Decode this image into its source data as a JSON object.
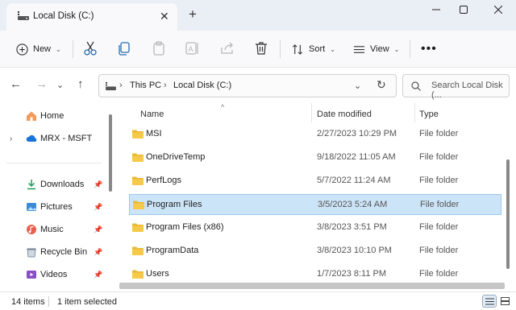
{
  "window": {
    "tab_title": "Local Disk (C:)"
  },
  "toolbar": {
    "new_label": "New",
    "sort_label": "Sort",
    "view_label": "View"
  },
  "address": {
    "crumbs": [
      "This PC",
      "Local Disk (C:)"
    ]
  },
  "search": {
    "placeholder": "Search Local Disk (..."
  },
  "sidebar": {
    "items": [
      {
        "label": "Home",
        "icon": "home-icon"
      },
      {
        "label": "MRX - MSFT",
        "icon": "cloud-icon"
      },
      {
        "label": "Downloads",
        "icon": "download-icon"
      },
      {
        "label": "Pictures",
        "icon": "pictures-icon"
      },
      {
        "label": "Music",
        "icon": "music-icon"
      },
      {
        "label": "Recycle Bin",
        "icon": "recycle-bin-icon"
      },
      {
        "label": "Videos",
        "icon": "videos-icon"
      }
    ]
  },
  "columns": {
    "name": "Name",
    "date": "Date modified",
    "type": "Type"
  },
  "files": [
    {
      "name": "MSI",
      "date": "2/27/2023 10:29 PM",
      "type": "File folder"
    },
    {
      "name": "OneDriveTemp",
      "date": "9/18/2022 11:05 AM",
      "type": "File folder"
    },
    {
      "name": "PerfLogs",
      "date": "5/7/2022 11:24 AM",
      "type": "File folder"
    },
    {
      "name": "Program Files",
      "date": "3/5/2023 5:24 AM",
      "type": "File folder"
    },
    {
      "name": "Program Files (x86)",
      "date": "3/8/2023 3:51 PM",
      "type": "File folder"
    },
    {
      "name": "ProgramData",
      "date": "3/8/2023 10:10 PM",
      "type": "File folder"
    },
    {
      "name": "Users",
      "date": "1/7/2023 8:11 PM",
      "type": "File folder"
    }
  ],
  "status": {
    "count": "14 items",
    "selected": "1 item selected"
  },
  "colors": {
    "selection": "#cce4f7",
    "folder": "#f6c94a",
    "accent": "#0067c0"
  }
}
